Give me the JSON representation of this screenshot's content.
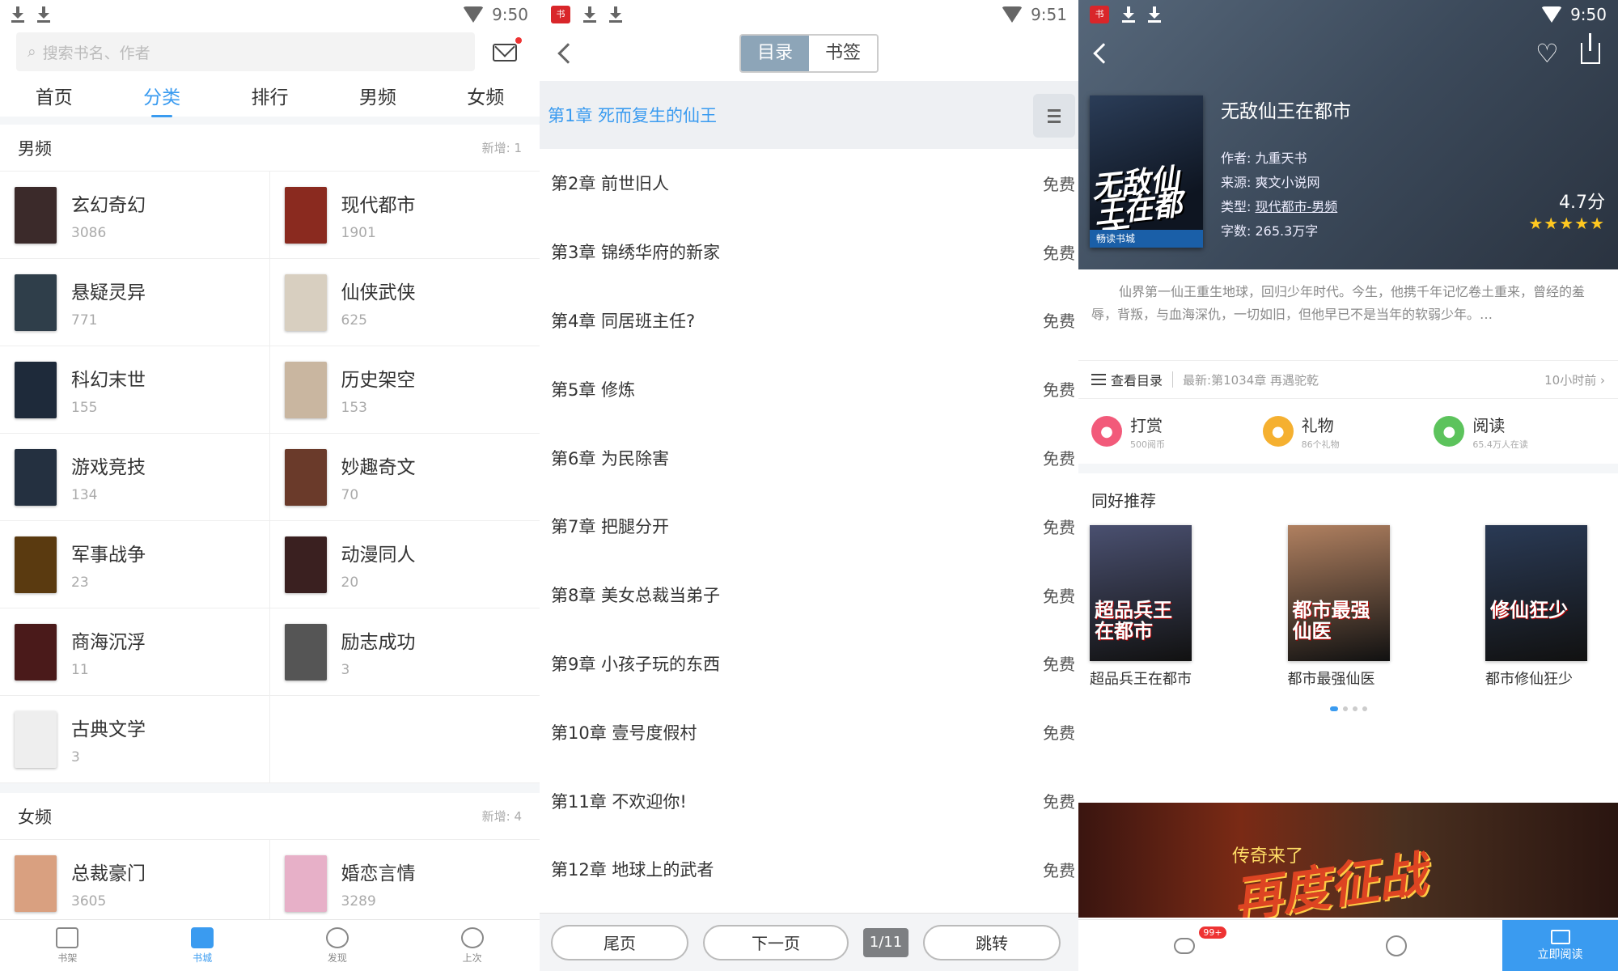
{
  "screen1": {
    "status": {
      "time": "9:50"
    },
    "search": {
      "placeholder": "搜索书名、作者"
    },
    "tabs": [
      {
        "label": "首页",
        "active": false
      },
      {
        "label": "分类",
        "active": true
      },
      {
        "label": "排行",
        "active": false
      },
      {
        "label": "男频",
        "active": false
      },
      {
        "label": "女频",
        "active": false
      }
    ],
    "male": {
      "title": "男频",
      "new": "新增: 1",
      "categories": [
        {
          "name": "玄幻奇幻",
          "count": "3086",
          "color": "#3b2a2a"
        },
        {
          "name": "现代都市",
          "count": "1901",
          "color": "#8a2a1f"
        },
        {
          "name": "悬疑灵异",
          "count": "771",
          "color": "#2f3e4a"
        },
        {
          "name": "仙侠武侠",
          "count": "625",
          "color": "#d8cfc0"
        },
        {
          "name": "科幻末世",
          "count": "155",
          "color": "#1e2a3a"
        },
        {
          "name": "历史架空",
          "count": "153",
          "color": "#c9b6a0"
        },
        {
          "name": "游戏竞技",
          "count": "134",
          "color": "#243040"
        },
        {
          "name": "妙趣奇文",
          "count": "70",
          "color": "#6a3a2a"
        },
        {
          "name": "军事战争",
          "count": "23",
          "color": "#5a3a10"
        },
        {
          "name": "动漫同人",
          "count": "20",
          "color": "#3a2020"
        },
        {
          "name": "商海沉浮",
          "count": "11",
          "color": "#4a1a1a"
        },
        {
          "name": "励志成功",
          "count": "3",
          "color": "#555555"
        },
        {
          "name": "古典文学",
          "count": "3",
          "color": "#eeeeee"
        }
      ]
    },
    "female": {
      "title": "女频",
      "new": "新增: 4",
      "categories": [
        {
          "name": "总裁豪门",
          "count": "3605",
          "color": "#d9a080"
        },
        {
          "name": "婚恋言情",
          "count": "3289",
          "color": "#e7b0c8"
        }
      ]
    },
    "bottom_nav": [
      {
        "label": "书架",
        "icon": "bookshelf-icon",
        "active": false
      },
      {
        "label": "书城",
        "icon": "bookstore-icon",
        "active": true
      },
      {
        "label": "发现",
        "icon": "discover-icon",
        "active": false
      },
      {
        "label": "上次",
        "icon": "history-icon",
        "active": false
      }
    ]
  },
  "screen2": {
    "status": {
      "time": "9:51",
      "badge": "书"
    },
    "segment": {
      "catalog": "目录",
      "bookmark": "书签"
    },
    "chapters": [
      {
        "title": "第1章 死而复生的仙王",
        "tag": ""
      },
      {
        "title": "第2章 前世旧人",
        "tag": "免费"
      },
      {
        "title": "第3章 锦绣华府的新家",
        "tag": "免费"
      },
      {
        "title": "第4章 同居班主任?",
        "tag": "免费"
      },
      {
        "title": "第5章 修炼",
        "tag": "免费"
      },
      {
        "title": "第6章 为民除害",
        "tag": "免费"
      },
      {
        "title": "第7章 把腿分开",
        "tag": "免费"
      },
      {
        "title": "第8章 美女总裁当弟子",
        "tag": "免费"
      },
      {
        "title": "第9章 小孩子玩的东西",
        "tag": "免费"
      },
      {
        "title": "第10章 壹号度假村",
        "tag": "免费"
      },
      {
        "title": "第11章 不欢迎你!",
        "tag": "免费"
      },
      {
        "title": "第12章 地球上的武者",
        "tag": "免费"
      }
    ],
    "pager": {
      "last": "尾页",
      "next": "下一页",
      "page": "1/11",
      "jump": "跳转"
    }
  },
  "screen3": {
    "status": {
      "time": "9:50",
      "badge": "书"
    },
    "book": {
      "title": "无敌仙王在都市",
      "cover_text": "无敌仙王在都市",
      "author": "作者: 九重天书",
      "source": "来源: 爽文小说网",
      "type_label": "类型: ",
      "type_value": "现代都市-男频",
      "words": "字数: 265.3万字",
      "rating": "4.7分",
      "stars": "★★★★★",
      "cover_publisher": "畅读书城"
    },
    "description": "仙界第一仙王重生地球，回归少年时代。今生，他携千年记忆卷土重来，曾经的羞辱，背叛，与血海深仇，一切如旧，但他早已不是当年的软弱少年。…",
    "catalog": {
      "label": "查看目录",
      "latest": "最新:第1034章 再遇驼乾",
      "time": "10小时前 ›"
    },
    "actions": [
      {
        "title": "打赏",
        "sub": "500阅币",
        "color": "#f25a7a",
        "icon": "money-bag-icon"
      },
      {
        "title": "礼物",
        "sub": "86个礼物",
        "color": "#f5b030",
        "icon": "gift-icon"
      },
      {
        "title": "阅读",
        "sub": "65.4万人在读",
        "color": "#5cc35c",
        "icon": "eye-icon"
      }
    ],
    "recommend_title": "同好推荐",
    "recommendations": [
      {
        "name": "超品兵王在都市",
        "cover_text": "超品兵王在都市",
        "color": "#4a5070"
      },
      {
        "name": "都市最强仙医",
        "cover_text": "都市最强仙医",
        "color": "#b08060"
      },
      {
        "name": "都市修仙狂少",
        "cover_text": "修仙狂少",
        "color": "#2a3a55"
      }
    ],
    "banner": {
      "small": "传奇来了",
      "big": "再度征战"
    },
    "bottom": {
      "chat_badge": "99+",
      "read_label": "立即阅读"
    }
  }
}
